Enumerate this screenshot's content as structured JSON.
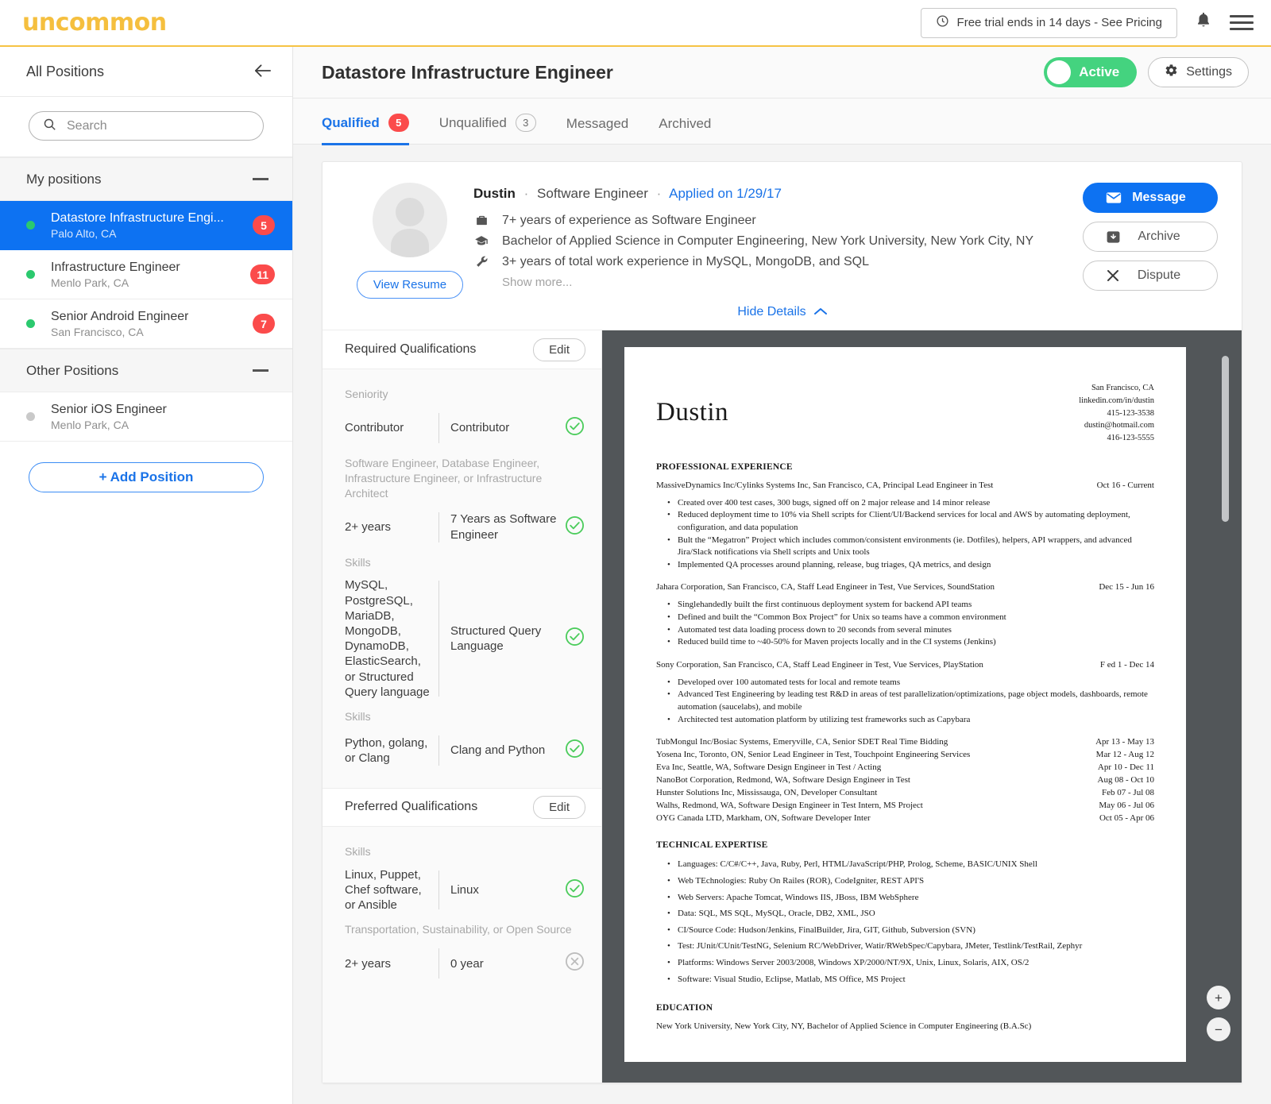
{
  "brand": {
    "logo_text": "uncommon",
    "logo_color": "#f5bf3e"
  },
  "topbar": {
    "trial_text": "Free trial ends in 14 days - See Pricing",
    "clock_icon": "clock-icon",
    "bell_icon": "bell-icon",
    "menu_icon": "hamburger-menu-icon"
  },
  "sidebar": {
    "header_title": "All Positions",
    "back_icon": "back-arrow-icon",
    "search": {
      "placeholder": "Search",
      "value": "",
      "icon": "search-icon"
    },
    "groups": [
      {
        "label": "My positions",
        "items": [
          {
            "title": "Datastore Infrastructure Engi...",
            "location": "Palo Alto, CA",
            "badge": "5",
            "status": "active",
            "selected": true
          },
          {
            "title": "Infrastructure Engineer",
            "location": "Menlo Park, CA",
            "badge": "11",
            "status": "active",
            "selected": false
          },
          {
            "title": "Senior Android Engineer",
            "location": "San Francisco, CA",
            "badge": "7",
            "status": "active",
            "selected": false
          }
        ]
      },
      {
        "label": "Other Positions",
        "items": [
          {
            "title": "Senior iOS Engineer",
            "location": "Menlo Park, CA",
            "badge": "",
            "status": "inactive",
            "selected": false
          }
        ]
      }
    ],
    "add_position_label": "+ Add Position"
  },
  "main": {
    "title": "Datastore Infrastructure Engineer",
    "toggle": {
      "label": "Active",
      "on": true,
      "color": "#44d37f"
    },
    "settings_label": "Settings",
    "settings_icon": "gear-icon",
    "tabs": [
      {
        "label": "Qualified",
        "badge": "5",
        "badge_style": "red",
        "selected": true
      },
      {
        "label": "Unqualified",
        "badge": "3",
        "badge_style": "ghost",
        "selected": false
      },
      {
        "label": "Messaged",
        "badge": "",
        "badge_style": "none",
        "selected": false
      },
      {
        "label": "Archived",
        "badge": "",
        "badge_style": "none",
        "selected": false
      }
    ]
  },
  "candidate": {
    "name": "Dustin",
    "role": "Software Engineer",
    "applied": "Applied on 1/29/17",
    "view_resume_label": "View Resume",
    "facts": [
      {
        "icon": "briefcase-icon",
        "text": "7+ years of experience as Software Engineer"
      },
      {
        "icon": "graduation-cap-icon",
        "text": "Bachelor of Applied Science in Computer Engineering, New York University, New York City, NY"
      },
      {
        "icon": "wrench-icon",
        "text": "3+ years of total work experience in MySQL, MongoDB, and SQL"
      }
    ],
    "show_more_label": "Show more...",
    "hide_details_label": "Hide Details",
    "actions": [
      {
        "label": "Message",
        "icon": "envelope-icon",
        "style": "primary"
      },
      {
        "label": "Archive",
        "icon": "archive-box-icon",
        "style": "default"
      },
      {
        "label": "Dispute",
        "icon": "close-x-icon",
        "style": "default"
      }
    ]
  },
  "qualifications": {
    "required": {
      "title": "Required Qualifications",
      "edit_label": "Edit",
      "rows": [
        {
          "category": "Seniority",
          "requirement": "Contributor",
          "value": "Contributor",
          "match": "pass"
        },
        {
          "category": "Software Engineer, Database Engineer, Infrastructure Engineer, or Infrastructure Architect",
          "requirement": "2+ years",
          "value": "7 Years as Software Engineer",
          "match": "pass"
        },
        {
          "category": "Skills",
          "requirement": "MySQL, PostgreSQL, MariaDB, MongoDB, DynamoDB, ElasticSearch, or Structured Query language",
          "value": "Structured Query Language",
          "match": "pass"
        },
        {
          "category": "Skills",
          "requirement": "Python, golang, or Clang",
          "value": "Clang and Python",
          "match": "pass"
        }
      ]
    },
    "preferred": {
      "title": "Preferred Qualifications",
      "edit_label": "Edit",
      "rows": [
        {
          "category": "Skills",
          "requirement": "Linux, Puppet, Chef software, or Ansible",
          "value": "Linux",
          "match": "pass"
        },
        {
          "category": "Transportation, Sustainability, or Open Source",
          "requirement": "2+ years",
          "value": "0 year",
          "match": "fail"
        }
      ]
    }
  },
  "resume_viewer": {
    "zoom_in_label": "+",
    "zoom_out_label": "−",
    "zoom_in_icon": "zoom-in-icon",
    "zoom_out_icon": "zoom-out-icon"
  },
  "resume": {
    "name": "Dustin",
    "contact": [
      "San Francisco, CA",
      "linkedin.com/in/dustin",
      "415-123-3538",
      "dustin@hotmail.com",
      "416-123-5555"
    ],
    "sections": {
      "experience_heading": "PROFESSIONAL EXPERIENCE",
      "technical_heading": "TECHNICAL EXPERTISE",
      "education_heading": "EDUCATION"
    },
    "jobs": [
      {
        "line": "MassiveDynamics Inc/Cylinks Systems Inc, San Francisco, CA, Principal Lead Engineer in Test",
        "dates": "Oct 16 - Current",
        "bullets": [
          "Created over 400 test cases, 300 bugs, signed off on 2 major release and 14 minor release",
          "Reduced deployment time to 10% via Shell scripts for Client/UI/Backend services for local and AWS by automating deployment, configuration, and data population",
          "Bult the “Megatron” Project which includes common/consistent environments (ie. Dotfiles), helpers, API wrappers, and advanced Jira/Slack notifications via Shell scripts and Unix tools",
          "Implemented QA processes around planning, release, bug triages, QA metrics, and design"
        ]
      },
      {
        "line": "Jahara Corporation, San Francisco, CA, Staff Lead Engineer in Test, Vue Services, SoundStation",
        "dates": "Dec 15 - Jun 16",
        "bullets": [
          "Singlehandedly built the first continuous deployment system for backend API teams",
          "Defined and built the “Common Box Project” for Unix so teams have a common environment",
          "Automated test data loading process down to 20 seconds from several minutes",
          "Reduced build time to ~40-50% for Maven projects locally and in the CI systems (Jenkins)"
        ]
      },
      {
        "line": "Sony Corporation, San Francisco, CA, Staff Lead Engineer in Test, Vue Services, PlayStation",
        "dates": "F ed 1 - Dec 14",
        "bullets": [
          "Developed over 100 automated tests for local and remote teams",
          "Advanced Test Engineering by leading test R&D in areas of test parallelization/optimizations, page object models, dashboards, remote automation (saucelabs), and mobile",
          "Architected test automation platform by utilizing test frameworks such as Capybara"
        ]
      }
    ],
    "short_jobs": [
      {
        "line": "TubMongul Inc/Bosiac Systems, Emeryville, CA, Senior SDET Real Time Bidding",
        "dates": "Apr 13 - May 13"
      },
      {
        "line": "Yosena Inc, Toronto, ON, Senior Lead Engineer in Test, Touchpoint Engineering Services",
        "dates": "Mar 12 - Aug 12"
      },
      {
        "line": "Eva Inc, Seattle, WA, Software Design Engineer in Test / Acting",
        "dates": "Apr 10 - Dec 11"
      },
      {
        "line": "NanoBot Corporation, Redmond, WA, Software Design Engineer in Test",
        "dates": "Aug 08 - Oct 10"
      },
      {
        "line": "Hunster Solutions Inc, Mississauga, ON, Developer Consultant",
        "dates": "Feb 07 - Jul 08"
      },
      {
        "line": "Walhs, Redmond, WA, Software Design Engineer in Test Intern, MS Project",
        "dates": "May 06 - Jul 06"
      },
      {
        "line": "OYG Canada LTD, Markham, ON, Software Developer Inter",
        "dates": "Oct 05 - Apr 06"
      }
    ],
    "technical": [
      "Languages: C/C#/C++, Java, Ruby, Perl, HTML/JavaScript/PHP, Prolog, Scheme, BASIC/UNIX Shell",
      "Web TEchnologies: Ruby On Railes (ROR), CodeIgniter, REST API'S",
      "Web Servers: Apache Tomcat, Windows IIS, JBoss, IBM WebSphere",
      "Data: SQL, MS SQL, MySQL, Oracle, DB2, XML, JSO",
      "CI/Source Code: Hudson/Jenkins, FinalBuilder, Jira, GIT, Github, Subversion (SVN)",
      "Test: JUnit/CUnit/TestNG, Selenium RC/WebDriver, Watir/RWebSpec/Capybara, JMeter, Testlink/TestRail, Zephyr",
      "Platforms: Windows Server 2003/2008, Windows XP/2000/NT/9X, Unix, Linux, Solaris, AIX, OS/2",
      "Software: Visual Studio, Eclipse, Matlab, MS Office, MS Project"
    ],
    "education": "New York University, New York City, NY, Bachelor of Applied Science in Computer Engineering (B.A.Sc)"
  }
}
